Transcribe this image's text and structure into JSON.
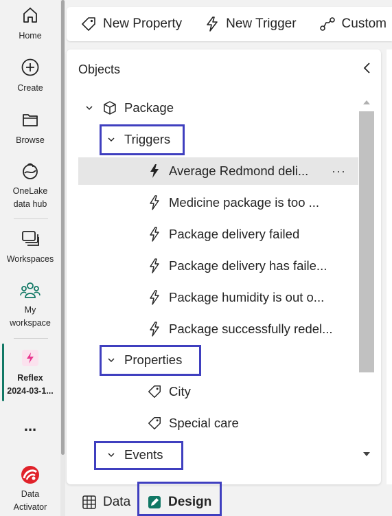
{
  "nav": {
    "items": [
      {
        "label": "Home",
        "icon": "home-icon"
      },
      {
        "label": "Create",
        "icon": "create-icon"
      },
      {
        "label": "Browse",
        "icon": "browse-icon"
      },
      {
        "label_line1": "OneLake",
        "label_line2": "data hub",
        "icon": "onelake-icon"
      },
      {
        "label": "Workspaces",
        "icon": "workspaces-icon"
      },
      {
        "label_line1": "My",
        "label_line2": "workspace",
        "icon": "my-workspace-icon"
      },
      {
        "label_line1": "Reflex",
        "label_line2": "2024-03-1...",
        "icon": "reflex-icon"
      },
      {
        "label": "...",
        "icon": "more-icon"
      },
      {
        "label_line1": "Data",
        "label_line2": "Activator",
        "icon": "data-activator-icon"
      }
    ]
  },
  "toolbar": {
    "new_property": "New Property",
    "new_trigger": "New Trigger",
    "custom": "Custom"
  },
  "panel": {
    "title": "Objects",
    "object": "Package",
    "triggers_label": "Triggers",
    "triggers": [
      "Average Redmond deli...",
      "Medicine package is too ...",
      "Package delivery failed",
      "Package delivery has faile...",
      "Package humidity is out o...",
      "Package successfully redel..."
    ],
    "selected_more": "···",
    "properties_label": "Properties",
    "properties": [
      "City",
      "Special care"
    ],
    "events_label": "Events"
  },
  "tabs": {
    "data": "Data",
    "design": "Design"
  },
  "colors": {
    "highlight": "#3f3fbf",
    "active_green": "#117865",
    "reflex_pink": "#e8388f",
    "activator_red": "#e0222a"
  }
}
